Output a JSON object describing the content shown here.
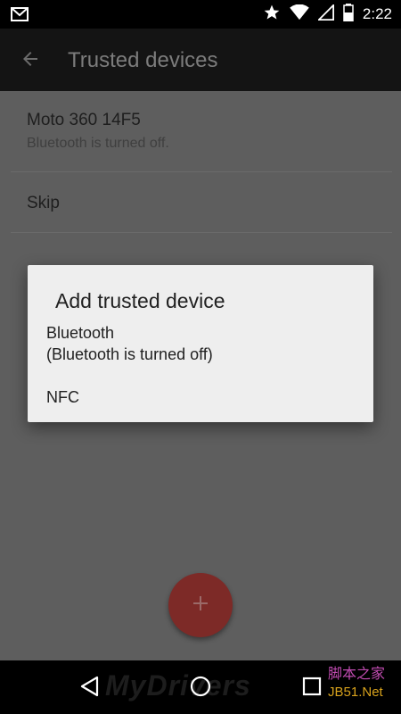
{
  "status_bar": {
    "time": "2:22",
    "icons": [
      "gmail-icon",
      "star-icon",
      "wifi-icon",
      "signal-icon",
      "battery-icon"
    ]
  },
  "app_bar": {
    "title": "Trusted devices",
    "back_icon": "arrow-back-icon"
  },
  "list": {
    "items": [
      {
        "primary": "Moto 360 14F5",
        "secondary": "Bluetooth is turned off."
      },
      {
        "primary": "Skip"
      }
    ]
  },
  "dialog": {
    "title": "Add trusted device",
    "options": [
      {
        "line1": "Bluetooth",
        "line2": "(Bluetooth is turned off)"
      },
      {
        "line1": "NFC"
      }
    ]
  },
  "fab": {
    "icon": "plus-icon"
  },
  "nav_bar": {
    "icons": [
      "nav-back-icon",
      "nav-home-icon",
      "nav-recents-icon"
    ]
  },
  "watermark": {
    "left_text": "MyDrivers",
    "right_text_line1": "脚本之家",
    "right_text_line2": "JB51.Net"
  },
  "colors": {
    "scrim_background": "#5e5e5e",
    "dialog_background": "#eeeeee",
    "fab_color": "#7d2a27",
    "app_bar": "#141414"
  }
}
